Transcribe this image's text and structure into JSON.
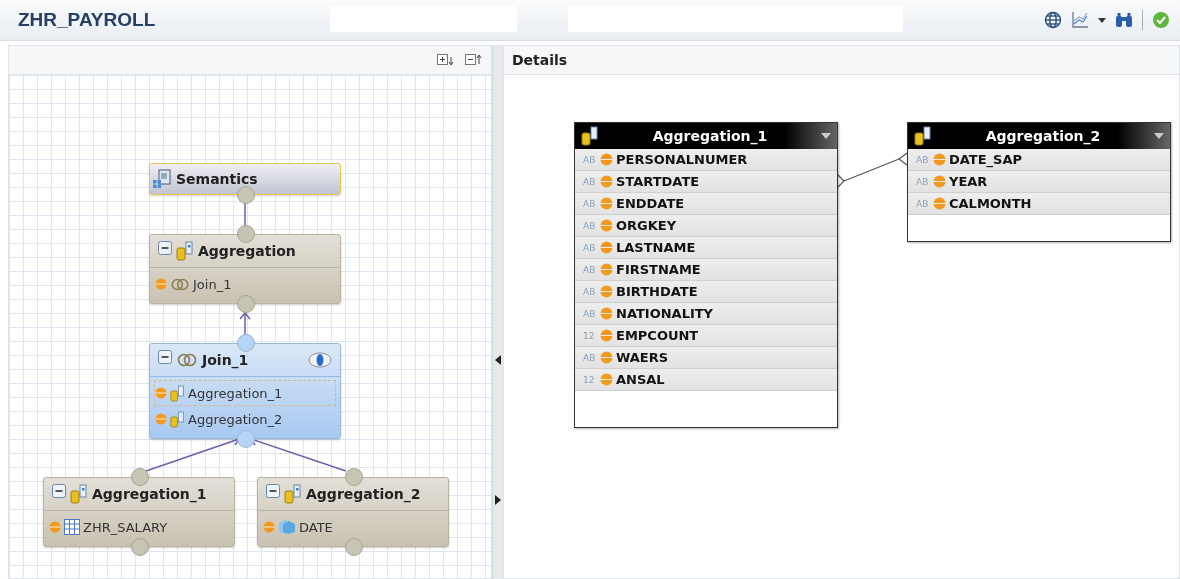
{
  "title": "ZHR_PAYROLL",
  "diagram": {
    "nodes": [
      {
        "kind": "semantics",
        "title": "Semantics"
      },
      {
        "kind": "aggregation",
        "title": "Aggregation",
        "rows": [
          {
            "kind": "join",
            "label": "Join_1",
            "selected": false
          }
        ]
      },
      {
        "kind": "join",
        "title": "Join_1",
        "rows": [
          {
            "kind": "aggregation",
            "label": "Aggregation_1",
            "selected": true
          },
          {
            "kind": "aggregation",
            "label": "Aggregation_2",
            "selected": false
          }
        ]
      },
      {
        "kind": "aggregation",
        "title": "Aggregation_1",
        "rows": [
          {
            "kind": "table",
            "label": "ZHR_SALARY",
            "selected": false
          }
        ]
      },
      {
        "kind": "aggregation",
        "title": "Aggregation_2",
        "rows": [
          {
            "kind": "cube",
            "label": "DATE",
            "selected": false
          }
        ]
      }
    ]
  },
  "details": {
    "title": "Details",
    "tables": [
      {
        "title": "Aggregation_1",
        "columns": [
          {
            "type": "AB",
            "name": "PERSONALNUMER"
          },
          {
            "type": "AB",
            "name": "STARTDATE"
          },
          {
            "type": "AB",
            "name": "ENDDATE"
          },
          {
            "type": "AB",
            "name": "ORGKEY"
          },
          {
            "type": "AB",
            "name": "LASTNAME"
          },
          {
            "type": "AB",
            "name": "FIRSTNAME"
          },
          {
            "type": "AB",
            "name": "BIRTHDATE"
          },
          {
            "type": "AB",
            "name": "NATIONALITY"
          },
          {
            "type": "12",
            "name": "EMPCOUNT"
          },
          {
            "type": "AB",
            "name": "WAERS"
          },
          {
            "type": "12",
            "name": "ANSAL"
          }
        ]
      },
      {
        "title": "Aggregation_2",
        "columns": [
          {
            "type": "AB",
            "name": "DATE_SAP"
          },
          {
            "type": "AB",
            "name": "YEAR"
          },
          {
            "type": "AB",
            "name": "CALMONTH"
          }
        ]
      }
    ]
  }
}
